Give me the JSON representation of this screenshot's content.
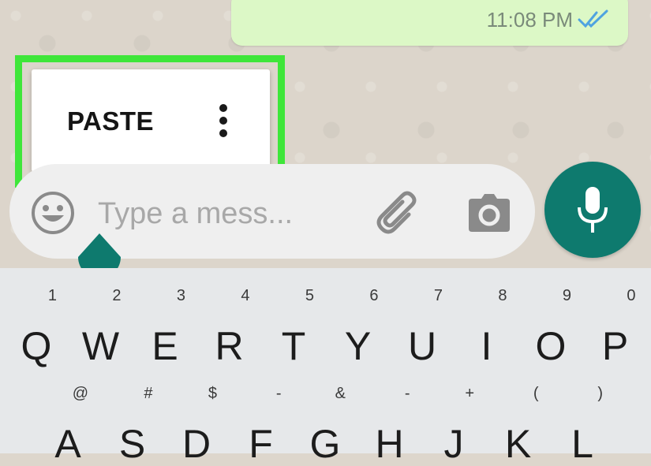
{
  "message": {
    "time": "11:08 PM",
    "status_icon": "double-check-icon",
    "bubble_color": "#dcf8c6",
    "tick_color": "#4fa3e0"
  },
  "context_menu": {
    "paste_label": "PASTE",
    "more_icon": "more-vertical-icon",
    "highlight_color": "#3fe63a"
  },
  "input_bar": {
    "placeholder": "Type a mess...",
    "emoji_icon": "emoji-icon",
    "attach_icon": "paperclip-icon",
    "camera_icon": "camera-icon"
  },
  "mic_button": {
    "icon": "microphone-icon",
    "color": "#0e7a6e"
  },
  "keyboard": {
    "row1": [
      {
        "letter": "Q",
        "hint": "1"
      },
      {
        "letter": "W",
        "hint": "2"
      },
      {
        "letter": "E",
        "hint": "3"
      },
      {
        "letter": "R",
        "hint": "4"
      },
      {
        "letter": "T",
        "hint": "5"
      },
      {
        "letter": "Y",
        "hint": "6"
      },
      {
        "letter": "U",
        "hint": "7"
      },
      {
        "letter": "I",
        "hint": "8"
      },
      {
        "letter": "O",
        "hint": "9"
      },
      {
        "letter": "P",
        "hint": "0"
      }
    ],
    "row2": [
      {
        "letter": "A",
        "hint": "@"
      },
      {
        "letter": "S",
        "hint": "#"
      },
      {
        "letter": "D",
        "hint": "$"
      },
      {
        "letter": "F",
        "hint": "-"
      },
      {
        "letter": "G",
        "hint": "&"
      },
      {
        "letter": "H",
        "hint": "-"
      },
      {
        "letter": "J",
        "hint": "+"
      },
      {
        "letter": "K",
        "hint": "("
      },
      {
        "letter": "L",
        "hint": ")"
      }
    ]
  }
}
